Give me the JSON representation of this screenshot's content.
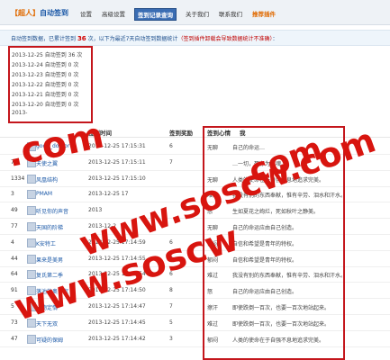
{
  "header": {
    "title_left": "【",
    "title_name": "超人",
    "title_right": "】",
    "title_rest": "自动签到",
    "nav": [
      {
        "label": "设置",
        "style": "normal"
      },
      {
        "label": "高级设置",
        "style": "normal"
      },
      {
        "label": "签到记录查询",
        "style": "active"
      },
      {
        "label": "关于我们",
        "style": "normal"
      },
      {
        "label": "联系我们",
        "style": "normal"
      },
      {
        "label": "推荐插件",
        "style": "orange"
      }
    ]
  },
  "info": {
    "prefix": "自动签到数据，已累计签到",
    "count": "36",
    "middle": "次，以下为最近7天自动签到数据统计",
    "warning": "（签到插件卸载会导致数据统计不准确）",
    "suffix": "："
  },
  "log": [
    "2013-12-25 自动签到 36 次",
    "2013-12-24 自动签到 0 次",
    "2013-12-23 自动签到 0 次",
    "2013-12-22 自动签到 0 次",
    "2013-12-21 自动签到 0 次",
    "2013-12-20 自动签到 0 次",
    "2013-"
  ],
  "table": {
    "headers": [
      "签到时间",
      "签到奖励",
      "签到心情",
      "我"
    ],
    "rows": [
      {
        "id": "",
        "name": "good_doctor",
        "time": "2013-12-25 17:15:31",
        "reward": "6",
        "mood": "无聊",
        "msg": "自己的命运…"
      },
      {
        "id": "75",
        "name": "天使之翼",
        "time": "2013-12-25 17:15:11",
        "reward": "7",
        "mood": "",
        "msg": "…一切，死存为鬼魂。"
      },
      {
        "id": "1334",
        "name": "风凰结构",
        "time": "2013-12-25 17:15:10",
        "reward": "",
        "mood": "无聊",
        "msg": "人类的使命在于自强不息地追求完美。"
      },
      {
        "id": "3",
        "name": "PMAM",
        "time": "2013-12-25 17",
        "reward": "",
        "mood": "难过",
        "msg": "我没有别的东西奉献，惟有辛劳、泪水和汗水。"
      },
      {
        "id": "49",
        "name": "听见你的声音",
        "time": "2013",
        "reward": "",
        "mood": "怒",
        "msg": "生如夏花之绚烂，死如秋叶之静美。"
      },
      {
        "id": "77",
        "name": "天国的阶梯",
        "time": "2013-12-2",
        "reward": "",
        "mood": "无聊",
        "msg": "自己的命运应由自己创造。"
      },
      {
        "id": "4",
        "name": "K安特工",
        "time": "2013-12-25 17:14:59",
        "reward": "6",
        "mood": "郁闷",
        "msg": "自信和希望是青年的特权。"
      },
      {
        "id": "44",
        "name": "果来是美男",
        "time": "2013-12-25 17:14:55",
        "reward": "6",
        "mood": "郁闷",
        "msg": "自信和希望是青年的特权。"
      },
      {
        "id": "64",
        "name": "复氏第二季",
        "time": "2013-12-25 17:14:54",
        "reward": "6",
        "mood": "难过",
        "msg": "我没有别的东西奉献，惟有辛劳、泪水和汗水。"
      },
      {
        "id": "91",
        "name": "落池的奥食家",
        "time": "2013-12-25 17:14:50",
        "reward": "8",
        "mood": "怒",
        "msg": "自己的命运应由自己创造。"
      },
      {
        "id": "5",
        "name": "一物定情",
        "time": "2013-12-25 17:14:47",
        "reward": "7",
        "mood": "擦汗",
        "msg": "即使跌倒一百次，也要一百次地站起来。"
      },
      {
        "id": "73",
        "name": "天下无双",
        "time": "2013-12-25 17:14:45",
        "reward": "5",
        "mood": "难过",
        "msg": "即使跌倒一百次，也要一百次地站起来。"
      },
      {
        "id": "47",
        "name": "可疑的保姆",
        "time": "2013-12-25 17:14:42",
        "reward": "3",
        "mood": "郁闷",
        "msg": "人类的使命在于自强不息地追求完美。"
      }
    ]
  },
  "watermarks": [
    ".com",
    "www.soscw.com",
    ".com",
    "www.soscw"
  ],
  "colors": {
    "accent": "#1d5aa8",
    "highlight": "#c4161c",
    "active_nav": "#3a6db3",
    "watermark": "#d8150f"
  }
}
